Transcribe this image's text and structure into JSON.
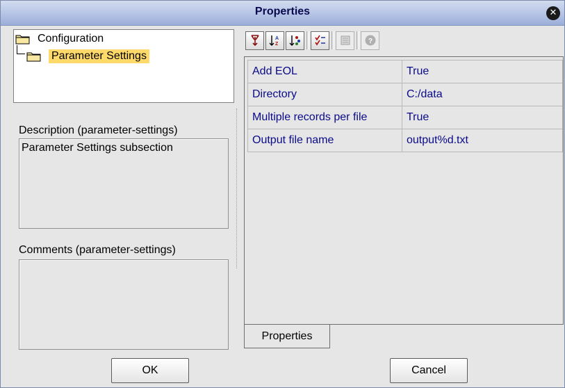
{
  "window": {
    "title": "Properties"
  },
  "tree": {
    "root": "Configuration",
    "child": "Parameter Settings"
  },
  "description": {
    "label": "Description (parameter-settings)",
    "text": "Parameter Settings subsection"
  },
  "comments": {
    "label": "Comments (parameter-settings)",
    "text": ""
  },
  "toolbar": {
    "icons": [
      "sort-category-icon",
      "sort-alpha-icon",
      "sort-type-icon",
      "filter-icon",
      "customize-icon",
      "help-icon"
    ]
  },
  "properties": {
    "rows": [
      {
        "name": "Add EOL",
        "value": "True"
      },
      {
        "name": "Directory",
        "value": "C:/data"
      },
      {
        "name": "Multiple records per file",
        "value": "True"
      },
      {
        "name": "Output file name",
        "value": "output%d.txt"
      }
    ],
    "tab_label": "Properties"
  },
  "buttons": {
    "ok": "OK",
    "cancel": "Cancel"
  },
  "colors": {
    "selection": "#ffd96a",
    "value_text": "#0a0a8a",
    "title_bar": "#b8c6e6"
  }
}
